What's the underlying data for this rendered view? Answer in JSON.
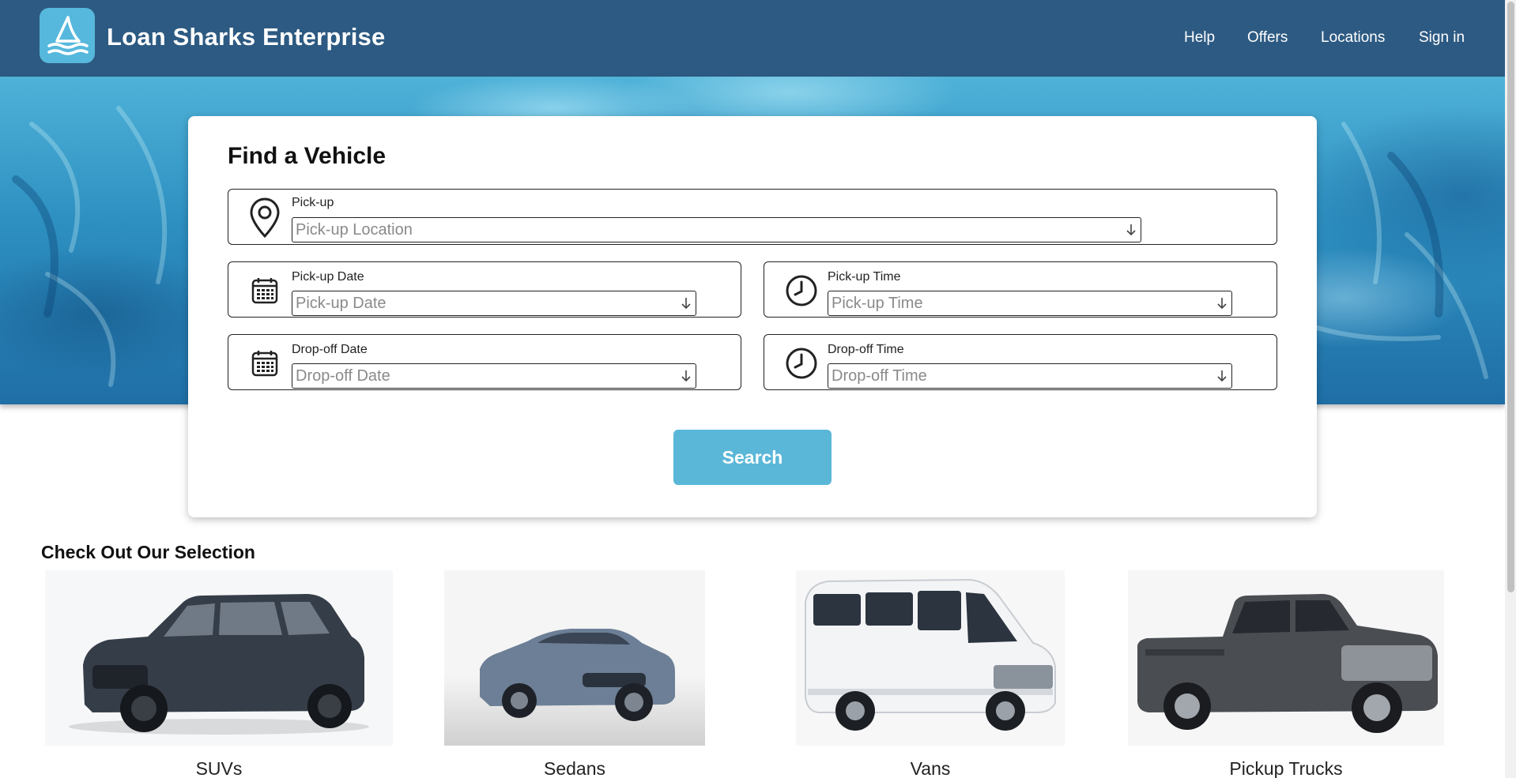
{
  "header": {
    "brand": "Loan Sharks Enterprise",
    "nav": [
      "Help",
      "Offers",
      "Locations",
      "Sign in"
    ],
    "logo_icon": "shark-fin-waves-icon"
  },
  "search_card": {
    "title": "Find a Vehicle",
    "pickup": {
      "label": "Pick-up",
      "placeholder": "Pick-up Location",
      "icon": "map-pin-icon"
    },
    "pickup_date": {
      "label": "Pick-up Date",
      "placeholder": "Pick-up Date",
      "icon": "calendar-icon"
    },
    "pickup_time": {
      "label": "Pick-up Time",
      "placeholder": "Pick-up Time",
      "icon": "clock-icon"
    },
    "dropoff_date": {
      "label": "Drop-off Date",
      "placeholder": "Drop-off Date",
      "icon": "calendar-icon"
    },
    "dropoff_time": {
      "label": "Drop-off Time",
      "placeholder": "Drop-off Time",
      "icon": "clock-icon"
    },
    "search_label": "Search"
  },
  "selection": {
    "title": "Check Out Our Selection",
    "items": [
      {
        "label": "SUVs"
      },
      {
        "label": "Sedans"
      },
      {
        "label": "Vans"
      },
      {
        "label": "Pickup Trucks"
      }
    ]
  },
  "colors": {
    "header_bg": "#2d5a82",
    "accent": "#5ab7d8",
    "logo_bg": "#56b8dc"
  }
}
